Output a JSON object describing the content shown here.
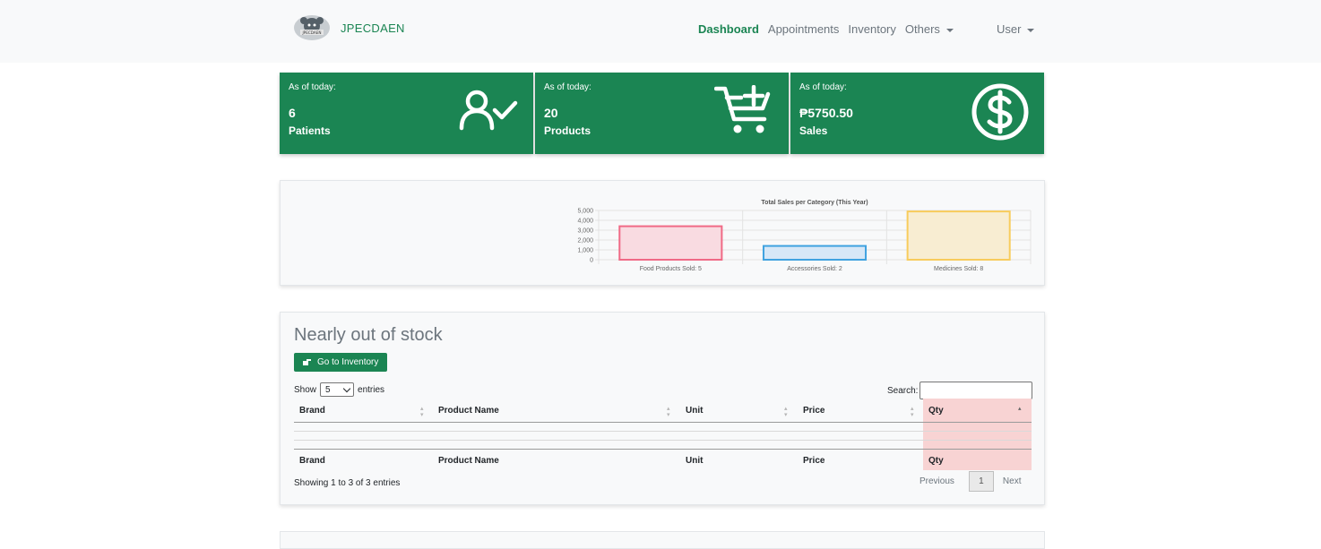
{
  "brand": {
    "name": "JPECDAEN",
    "logo_text": "JPECDAEN"
  },
  "nav": {
    "dashboard": "Dashboard",
    "appointments": "Appointments",
    "inventory": "Inventory",
    "others": "Others",
    "user": "User"
  },
  "cards": [
    {
      "asof": "As of today:",
      "value": "6",
      "label": "Patients",
      "icon": "user-check-icon"
    },
    {
      "asof": "As of today:",
      "value": "20",
      "label": "Products",
      "icon": "cart-plus-icon"
    },
    {
      "asof": "As of today:",
      "value": "₱5750.50",
      "label": "Sales",
      "icon": "dollar-circle-icon"
    }
  ],
  "colors": {
    "brand_green": "#1b8553",
    "qty_highlight": "#f8d3d3"
  },
  "chart_data": {
    "type": "bar",
    "title": "Total Sales per Category (This Year)",
    "categories": [
      "Food Products  Sold: 5",
      "Accessories  Sold: 2",
      "Medicines  Sold: 8"
    ],
    "values": [
      3400,
      1400,
      4900
    ],
    "ylim": [
      0,
      5000
    ],
    "yticks": [
      "5,000",
      "4,000",
      "3,000",
      "2,000",
      "1,000",
      "0"
    ],
    "bar_colors": [
      {
        "fill": "#f9dbe1",
        "stroke": "#f06a86"
      },
      {
        "fill": "#d6e7f7",
        "stroke": "#3fa2e0"
      },
      {
        "fill": "#f8edd2",
        "stroke": "#f8cc5c"
      }
    ],
    "grid": true
  },
  "stock": {
    "title": "Nearly out of stock",
    "button": "Go to Inventory",
    "show": "Show",
    "entries_value": "5",
    "entries": "entries",
    "search_label": "Search:",
    "search_value": "",
    "columns": [
      "Brand",
      "Product Name",
      "Unit",
      "Price",
      "Qty"
    ],
    "footer_columns": [
      "Brand",
      "Product Name",
      "Unit",
      "Price",
      "Qty"
    ],
    "showing": "Showing 1 to 3 of 3 entries",
    "prev": "Previous",
    "page": "1",
    "next": "Next"
  }
}
